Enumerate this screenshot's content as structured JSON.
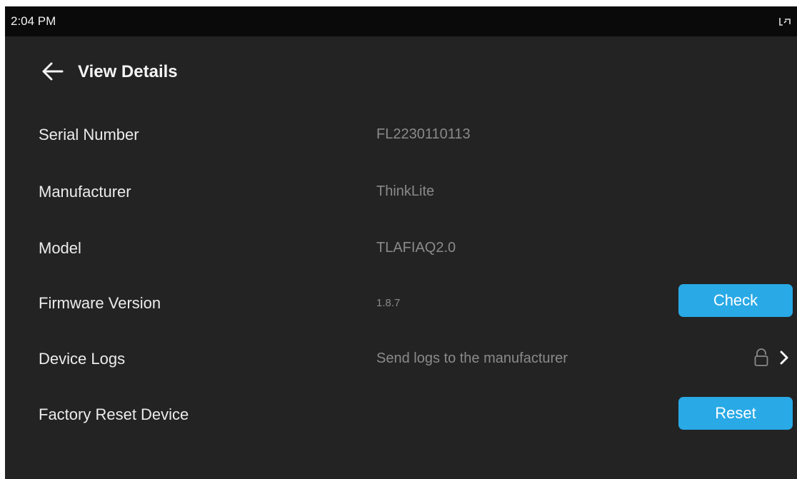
{
  "status_bar": {
    "time": "2:04 PM",
    "right_icon": "cast-icon"
  },
  "header": {
    "back_icon": "arrow-left-icon",
    "title": "View Details"
  },
  "details": {
    "serial": {
      "label": "Serial Number",
      "value": "FL2230110113"
    },
    "manufacturer": {
      "label": "Manufacturer",
      "value": "ThinkLite"
    },
    "model": {
      "label": "Model",
      "value": "TLAFIAQ2.0"
    },
    "firmware": {
      "label": "Firmware Version",
      "value": "1.8.7",
      "button": "Check"
    },
    "logs": {
      "label": "Device Logs",
      "value": "Send logs to the manufacturer",
      "icons": [
        "lock-icon",
        "chevron-right-icon"
      ]
    },
    "reset": {
      "label": "Factory Reset Device",
      "button": "Reset"
    }
  },
  "colors": {
    "background": "#232323",
    "status_bar": "#0a0a0a",
    "accent": "#29a9e6",
    "label_text": "#ececec",
    "value_text": "#8a8a8a"
  }
}
